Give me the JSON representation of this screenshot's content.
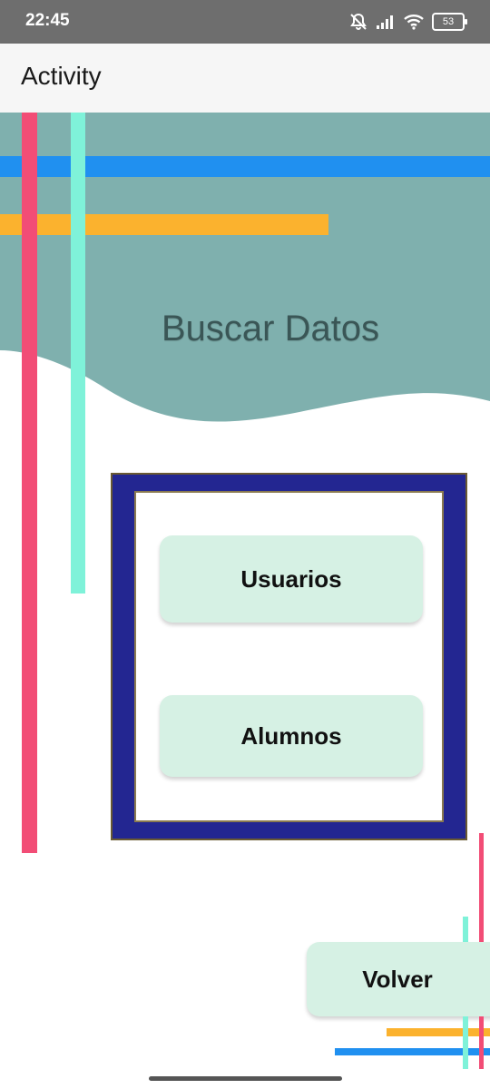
{
  "status_bar": {
    "time": "22:45",
    "icons": [
      "silent-icon",
      "signal-icon",
      "wifi-icon",
      "battery-icon"
    ],
    "battery_level": "53"
  },
  "app_bar": {
    "title": "Activity"
  },
  "header": {
    "title": "Buscar Datos"
  },
  "menu": {
    "usuarios_label": "Usuarios",
    "alumnos_label": "Alumnos"
  },
  "footer": {
    "volver_label": "Volver"
  },
  "colors": {
    "status_bar": "#6e6e6e",
    "app_bar": "#f6f6f6",
    "header_teal": "#7fb0ae",
    "stripe_pink": "#f24d76",
    "stripe_mint": "#7ff2d9",
    "stripe_blue": "#2090f0",
    "stripe_orange": "#fbb22e",
    "card_frame": "#232691",
    "button_mint": "#d6f1e4"
  }
}
